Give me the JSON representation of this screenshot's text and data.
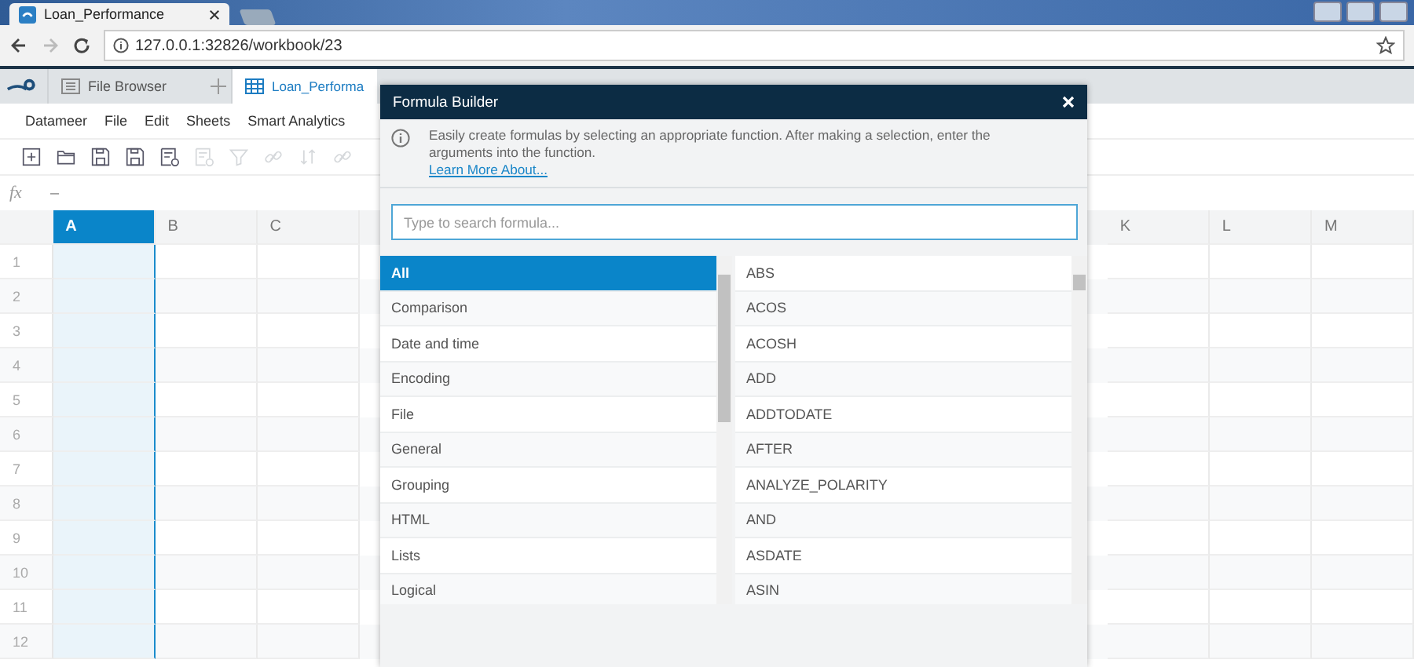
{
  "browser": {
    "tab_title": "Loan_Performance",
    "address": "127.0.0.1:32826/workbook/23"
  },
  "app_tabs": [
    {
      "label": "File Browser",
      "selected": false,
      "kind": "browser"
    },
    {
      "label": "Loan_Performa",
      "selected": true,
      "kind": "workbook"
    }
  ],
  "menu": [
    "Datameer",
    "File",
    "Edit",
    "Sheets",
    "Smart Analytics"
  ],
  "toolbar": [
    {
      "kind": "add",
      "disabled": false
    },
    {
      "kind": "folder",
      "disabled": false
    },
    {
      "kind": "save",
      "disabled": false
    },
    {
      "kind": "save",
      "disabled": false
    },
    {
      "kind": "sheet",
      "disabled": false
    },
    {
      "kind": "sheet",
      "disabled": true
    },
    {
      "kind": "filter",
      "disabled": true
    },
    {
      "kind": "link",
      "disabled": true
    },
    {
      "kind": "sort",
      "disabled": true
    },
    {
      "kind": "link",
      "disabled": true
    }
  ],
  "formula_bar": {
    "label": "fx",
    "value": "–"
  },
  "sheet": {
    "columns": [
      {
        "label": "A",
        "selected": true
      },
      {
        "label": "B",
        "selected": false
      },
      {
        "label": "C",
        "selected": false
      },
      {
        "label": "K",
        "selected": false
      },
      {
        "label": "L",
        "selected": false
      },
      {
        "label": "M",
        "selected": false
      }
    ],
    "rows": [
      "1",
      "2",
      "3",
      "4",
      "5",
      "6",
      "7",
      "8",
      "9",
      "10",
      "11",
      "12"
    ]
  },
  "dialog": {
    "title": "Formula Builder",
    "info": "Easily create formulas by selecting an appropriate function. After making a selection, enter the arguments into the function.",
    "link": "Learn More About...",
    "search": {
      "placeholder": "Type to search formula..."
    },
    "categories": [
      {
        "label": "All",
        "selected": true
      },
      {
        "label": "Comparison",
        "selected": false
      },
      {
        "label": "Date and time",
        "selected": false
      },
      {
        "label": "Encoding",
        "selected": false
      },
      {
        "label": "File",
        "selected": false
      },
      {
        "label": "General",
        "selected": false
      },
      {
        "label": "Grouping",
        "selected": false
      },
      {
        "label": "HTML",
        "selected": false
      },
      {
        "label": "Lists",
        "selected": false
      },
      {
        "label": "Logical",
        "selected": false
      }
    ],
    "functions": [
      "ABS",
      "ACOS",
      "ACOSH",
      "ADD",
      "ADDTODATE",
      "AFTER",
      "ANALYZE_POLARITY",
      "AND",
      "ASDATE",
      "ASIN"
    ]
  }
}
